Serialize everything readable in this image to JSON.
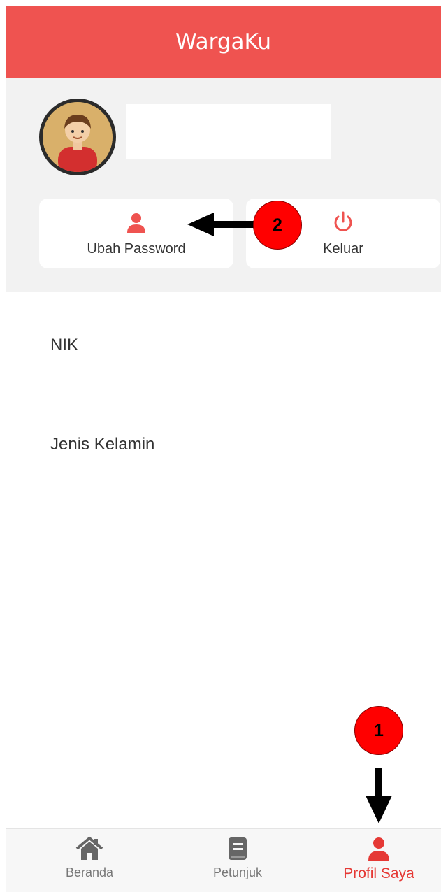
{
  "header": {
    "title": "WargaKu"
  },
  "profile": {
    "avatar": "avatar-icon",
    "actions": [
      {
        "label": "Ubah Password",
        "icon": "user-icon"
      },
      {
        "label": "Keluar",
        "icon": "power-icon"
      }
    ]
  },
  "fields": [
    {
      "label": "NIK"
    },
    {
      "label": "Jenis Kelamin"
    }
  ],
  "bottom_nav": [
    {
      "label": "Beranda",
      "icon": "home-icon",
      "active": false
    },
    {
      "label": "Petunjuk",
      "icon": "book-icon",
      "active": false
    },
    {
      "label": "Profil Saya",
      "icon": "user-icon",
      "active": true
    }
  ],
  "annotations": [
    {
      "number": "1"
    },
    {
      "number": "2"
    }
  ],
  "colors": {
    "accent": "#ef5350",
    "active_nav": "#e53935",
    "badge": "#ff0000"
  }
}
